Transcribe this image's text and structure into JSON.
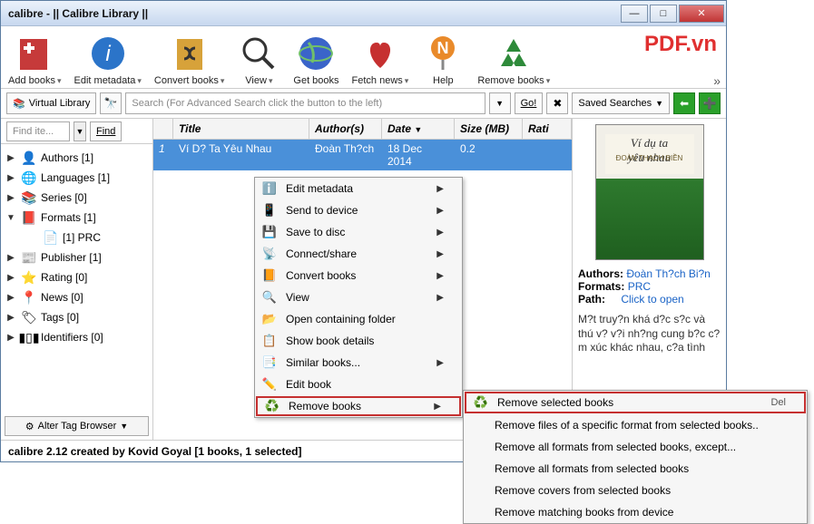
{
  "window": {
    "title": "calibre - || Calibre Library ||"
  },
  "watermark": "PDF.vn",
  "toolbar": [
    {
      "label": "Add books"
    },
    {
      "label": "Edit metadata"
    },
    {
      "label": "Convert books"
    },
    {
      "label": "View"
    },
    {
      "label": "Get books"
    },
    {
      "label": "Fetch news"
    },
    {
      "label": "Help"
    },
    {
      "label": "Remove books"
    }
  ],
  "search": {
    "virtual_library": "Virtual Library",
    "placeholder": "Search (For Advanced Search click the button to the left)",
    "go": "Go!",
    "saved": "Saved Searches"
  },
  "find": {
    "placeholder": "Find ite...",
    "button": "Find"
  },
  "columns": {
    "title": "Title",
    "authors": "Author(s)",
    "date": "Date",
    "size": "Size (MB)",
    "rating": "Rati"
  },
  "books": [
    {
      "num": "1",
      "title": "Ví D? Ta Yêu Nhau",
      "author": "Đoàn Th?ch",
      "date": "18 Dec 2014",
      "size": "0.2"
    }
  ],
  "tagbrowser": {
    "rows": [
      {
        "tw": "▶",
        "icon": "author",
        "label": "Authors [1]"
      },
      {
        "tw": "▶",
        "icon": "globe",
        "label": "Languages [1]"
      },
      {
        "tw": "▶",
        "icon": "books",
        "label": "Series [0]"
      },
      {
        "tw": "▼",
        "icon": "book",
        "label": "Formats [1]"
      },
      {
        "tw": "",
        "icon": "file",
        "label": "[1] PRC",
        "sub": true
      },
      {
        "tw": "▶",
        "icon": "news",
        "label": "Publisher [1]"
      },
      {
        "tw": "▶",
        "icon": "star",
        "label": "Rating [0]"
      },
      {
        "tw": "▶",
        "icon": "pin",
        "label": "News [0]"
      },
      {
        "tw": "▶",
        "icon": "tag",
        "label": "Tags [0]"
      },
      {
        "tw": "▶",
        "icon": "barcode",
        "label": "Identifiers [0]"
      }
    ],
    "alter": "Alter Tag Browser"
  },
  "details": {
    "cover_title": "Ví dụ ta\nyêu nhau",
    "cover_sub": "ĐOÀN THẠCH BIỀN",
    "authors_label": "Authors:",
    "authors": "Đoàn Th?ch Bi?n",
    "formats_label": "Formats:",
    "formats": "PRC",
    "path_label": "Path:",
    "path": "Click to open",
    "desc": "M?t truy?n khá d?c s?c và thú v? v?i nh?ng cung b?c c?m xúc khác nhau, c?a tình"
  },
  "status": "calibre 2.12 created by Kovid Goyal    [1 books, 1 selected]",
  "ctx1": [
    {
      "icon": "info",
      "label": "Edit metadata",
      "sub": true
    },
    {
      "icon": "device",
      "label": "Send to device",
      "sub": true
    },
    {
      "icon": "disc",
      "label": "Save to disc",
      "sub": true
    },
    {
      "icon": "share",
      "label": "Connect/share",
      "sub": true
    },
    {
      "icon": "convert",
      "label": "Convert books",
      "sub": true
    },
    {
      "icon": "view",
      "label": "View",
      "sub": true
    },
    {
      "icon": "folder",
      "label": "Open containing folder"
    },
    {
      "icon": "details",
      "label": "Show book details"
    },
    {
      "icon": "similar",
      "label": "Similar books...",
      "sub": true
    },
    {
      "icon": "edit",
      "label": "Edit book"
    },
    {
      "icon": "remove",
      "label": "Remove books",
      "sub": true,
      "hl": true
    }
  ],
  "ctx2": [
    {
      "icon": "remove",
      "label": "Remove selected books",
      "shortcut": "Del",
      "hl": true
    },
    {
      "label": "Remove files of a specific format from selected books.."
    },
    {
      "label": "Remove all formats from selected books, except..."
    },
    {
      "label": "Remove all formats from selected books"
    },
    {
      "label": "Remove covers from selected books"
    },
    {
      "label": "Remove matching books from device"
    }
  ]
}
